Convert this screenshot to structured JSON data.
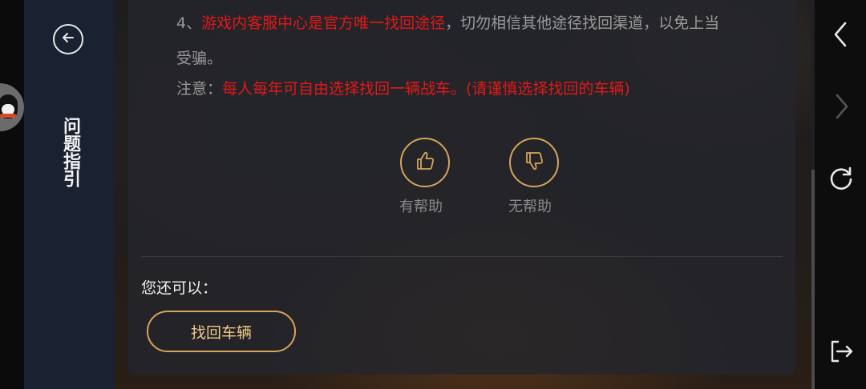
{
  "sidebar": {
    "title": "问题指引"
  },
  "content": {
    "line1_prefix": "4、",
    "line1_red": "游戏内客服中心是官方唯一找回途径",
    "line1_rest": "，切勿相信其他途径找回渠道，以免上当",
    "line2": "受骗。",
    "note_label": "注意：",
    "note_red": "每人每年可自由选择找回一辆战车。(请谨慎选择找回的车辆)"
  },
  "feedback": {
    "helpful_label": "有帮助",
    "unhelpful_label": "无帮助"
  },
  "actions": {
    "heading": "您还可以：",
    "retrieve_label": "找回车辆"
  },
  "colors": {
    "accent_gold": "#d6a45a",
    "warning_red": "#e31818",
    "sidebar_bg": "#1a2130"
  },
  "icons": {
    "back": "arrow-left-circle-icon",
    "helpful": "thumbs-up-icon",
    "unhelpful": "thumbs-down-icon",
    "nav_back": "chevron-left-icon",
    "nav_forward": "chevron-right-icon",
    "refresh": "refresh-icon",
    "exit": "exit-icon"
  }
}
